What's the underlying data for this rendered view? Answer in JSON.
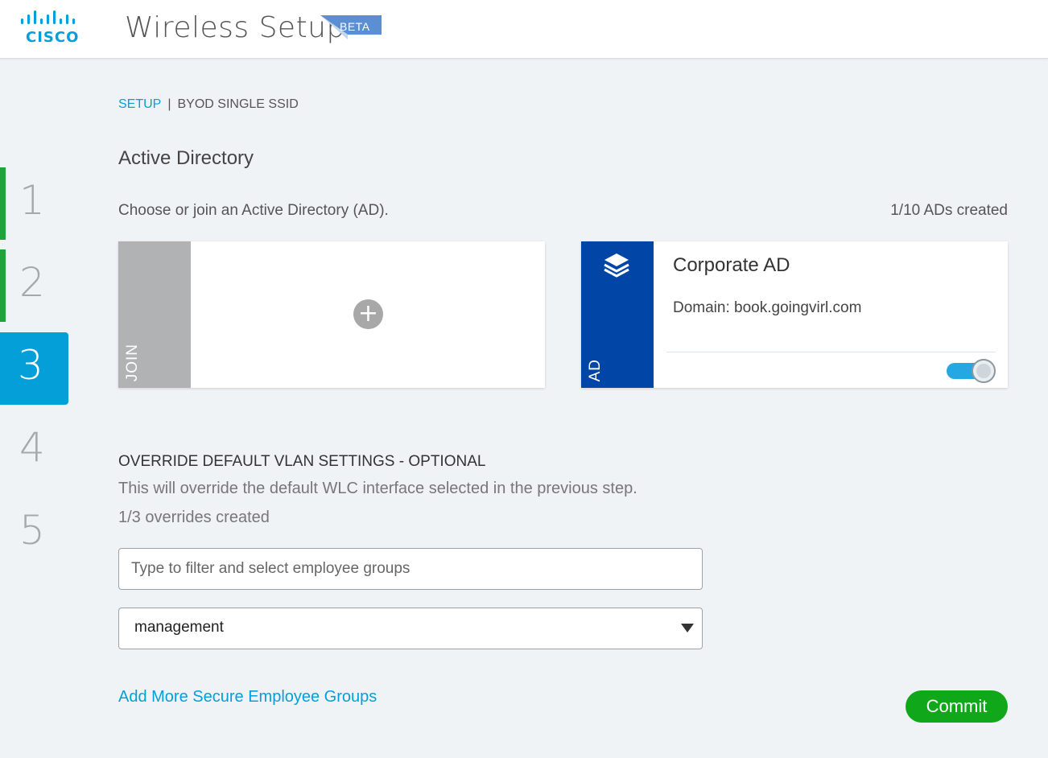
{
  "header": {
    "logo_text": "CISCO",
    "app_title": "Wireless Setup",
    "beta_label": "BETA"
  },
  "steps": [
    {
      "label": "1",
      "state": "done"
    },
    {
      "label": "2",
      "state": "done"
    },
    {
      "label": "3",
      "state": "active"
    },
    {
      "label": "4",
      "state": "pending"
    },
    {
      "label": "5",
      "state": "pending"
    }
  ],
  "breadcrumb": {
    "link": "SETUP",
    "separator": "|",
    "current": "BYOD SINGLE SSID"
  },
  "active_directory": {
    "title": "Active Directory",
    "instructions": "Choose or join an Active Directory (AD).",
    "count": "1/10 ADs created",
    "join_card": {
      "side_label": "JOIN",
      "add_symbol": "+",
      "add_icon": "plus-icon"
    },
    "ad_card": {
      "side_label": "AD",
      "icon": "layers-icon",
      "name": "Corporate AD",
      "domain": "Domain: book.goingvirl.com",
      "enabled": true
    }
  },
  "vlan": {
    "title": "OVERRIDE DEFAULT VLAN SETTINGS - OPTIONAL",
    "description": "This will override the default WLC interface selected in the previous step.",
    "count": "1/3 overrides created",
    "filter_placeholder": "Type to filter and select employee groups",
    "filter_value": "",
    "interface_selected": "management"
  },
  "actions": {
    "add_more_label": "Add More Secure Employee Groups",
    "commit_label": "Commit"
  },
  "colors": {
    "accent": "#049fd9",
    "done": "#1ba53b",
    "ad_blue": "#0146a6",
    "join_gray": "#b1b2b3",
    "commit_green": "#11a71a"
  }
}
